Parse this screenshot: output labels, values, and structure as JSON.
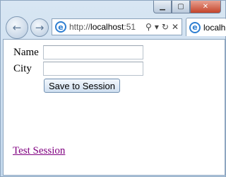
{
  "toolbar": {
    "url_prefix": "http://",
    "url_host": "localhost",
    "url_port": ":51",
    "tab_title": "localh"
  },
  "form": {
    "name_label": "Name",
    "name_value": "",
    "city_label": "City",
    "city_value": "",
    "save_button": "Save to Session"
  },
  "links": {
    "test_session": "Test Session"
  }
}
